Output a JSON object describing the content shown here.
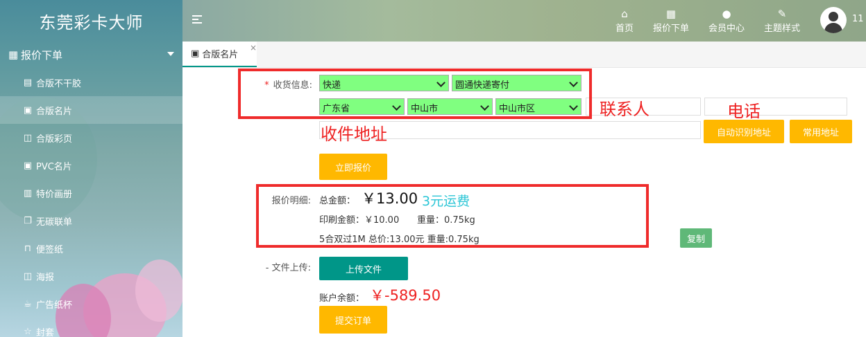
{
  "app": {
    "brand": "东莞彩卡大师"
  },
  "sidebar": {
    "section": {
      "label": "报价下单"
    },
    "items": [
      {
        "label": "合版不干胶",
        "icon": "document-icon"
      },
      {
        "label": "合版名片",
        "icon": "id-card-icon",
        "active": true
      },
      {
        "label": "合版彩页",
        "icon": "map-icon"
      },
      {
        "label": "PVC名片",
        "icon": "id-card-icon"
      },
      {
        "label": "特价画册",
        "icon": "book-icon"
      },
      {
        "label": "无碳联单",
        "icon": "copy-icon"
      },
      {
        "label": "便签纸",
        "icon": "bookmark-icon"
      },
      {
        "label": "海报",
        "icon": "map-icon"
      },
      {
        "label": "广告纸杯",
        "icon": "cup-icon"
      },
      {
        "label": "封套",
        "icon": "star-icon"
      }
    ]
  },
  "topnav": {
    "home": "首页",
    "quote": "报价下单",
    "member": "会员中心",
    "theme": "主题样式",
    "user_id": "11"
  },
  "tabs": [
    {
      "label": "合版名片"
    }
  ],
  "form": {
    "shipping_label": "收货信息:",
    "shipping_method": "快递",
    "courier": "圆通快递寄付",
    "province": "广东省",
    "city": "中山市",
    "district": "中山市区",
    "contact_annotation": "联系人",
    "phone_annotation": "电话",
    "address_annotation": "收件地址",
    "auto_address_btn": "自动识别地址",
    "common_address_btn": "常用地址",
    "quote_btn": "立即报价",
    "quote_detail_label": "报价明细:",
    "total_label": "总金额：",
    "total_value": "￥13.00",
    "shipping_annotation": "3元运费",
    "print_amount": "印刷金额：￥10.00",
    "weight": "重量：0.75kg",
    "summary_line": "5合双过1M 总价:13.00元 重量:0.75kg",
    "copy_btn": "复制",
    "upload_label": "- 文件上传:",
    "upload_btn": "上传文件",
    "balance_label": "账户余额：",
    "balance_value": "￥-589.50",
    "submit_btn": "提交订单"
  },
  "colors": {
    "select_bg": "#80ff80",
    "accent_yellow": "#ffb800",
    "accent_teal": "#009688",
    "annotation_red": "#ef2b2b",
    "annotation_cyan": "#2cc6d6"
  }
}
